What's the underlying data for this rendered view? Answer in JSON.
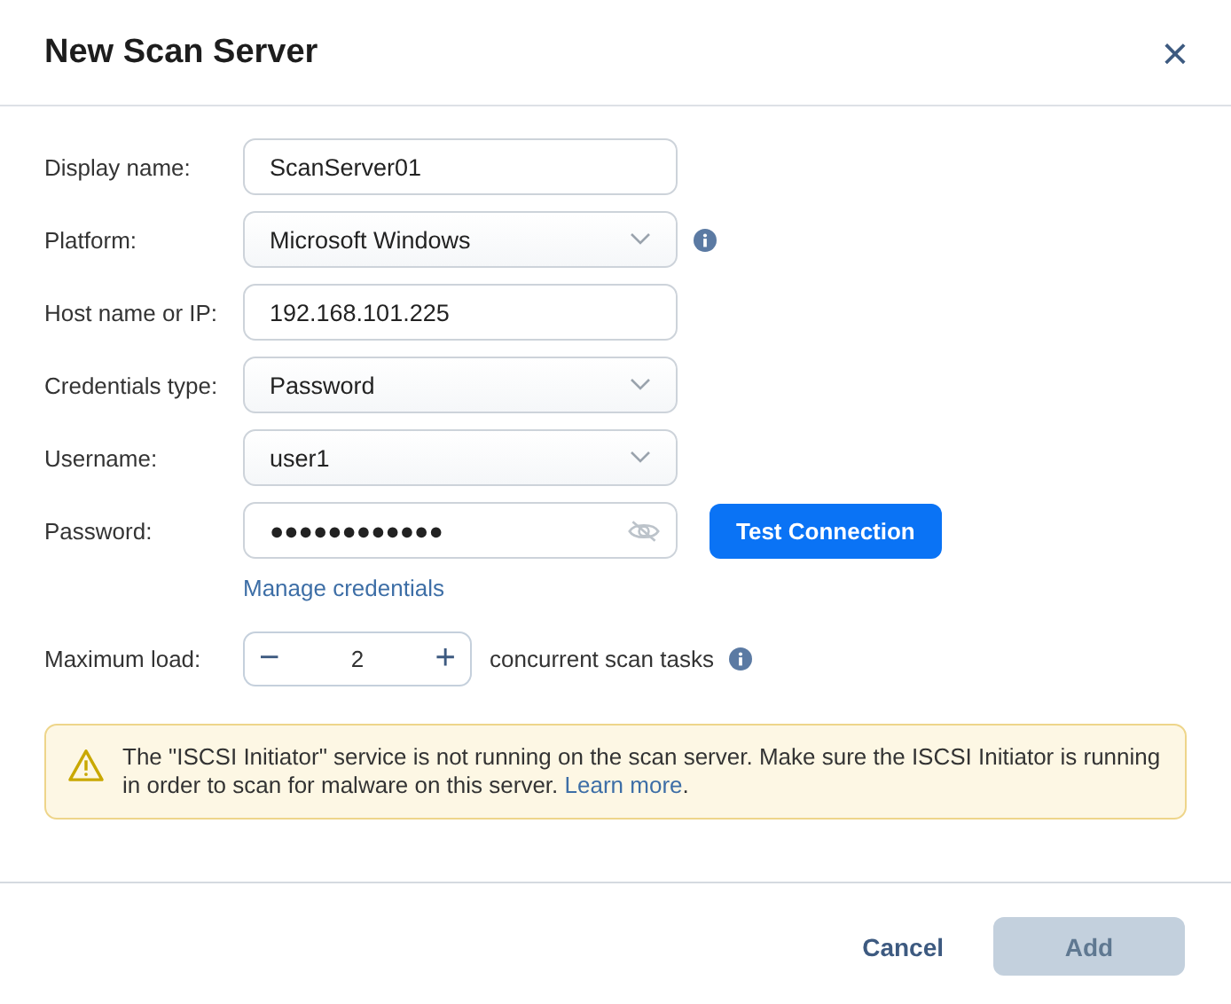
{
  "dialog": {
    "title": "New Scan Server",
    "close": "×"
  },
  "fields": [
    {
      "kind": "text",
      "label": "Display name:",
      "value": "ScanServer01"
    },
    {
      "kind": "select",
      "label": "Platform:",
      "value": "Microsoft Windows",
      "info": true
    },
    {
      "kind": "text",
      "label": "Host name or IP:",
      "value": "192.168.101.225"
    },
    {
      "kind": "select",
      "label": "Credentials type:",
      "value": "Password"
    },
    {
      "kind": "select",
      "label": "Username:",
      "value": "user1"
    },
    {
      "kind": "password",
      "label": "Password:",
      "value": "●●●●●●●●●●●●",
      "button": "Test Connection",
      "link": "Manage credentials"
    }
  ],
  "max_load": {
    "label": "Maximum load:",
    "minus": "−",
    "value": "2",
    "plus": "+",
    "suffix": "concurrent scan tasks",
    "info": true
  },
  "warning": {
    "text": "The \"ISCSI Initiator\" service is not running on the scan server. Make sure the ISCSI Initiator is running in order to scan for malware on this server.",
    "link": "Learn more",
    "end": "."
  },
  "footer": {
    "cancel": "Cancel",
    "add": {
      "label": "Add",
      "disabled": true
    }
  }
}
